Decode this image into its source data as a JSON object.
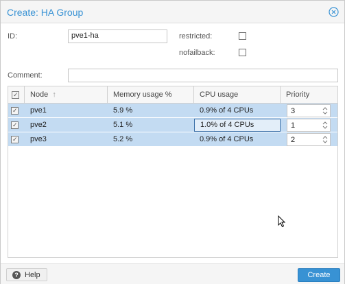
{
  "dialog": {
    "title": "Create: HA Group",
    "close_icon": "close-circle-icon",
    "accent": "#3892d4"
  },
  "form": {
    "id_label": "ID:",
    "id_value": "pve1-ha",
    "restricted_label": "restricted:",
    "restricted_checked": false,
    "nofailback_label": "nofailback:",
    "nofailback_checked": false,
    "comment_label": "Comment:",
    "comment_value": ""
  },
  "grid": {
    "columns": [
      "Node",
      "Memory usage %",
      "CPU usage",
      "Priority"
    ],
    "sort_icon": "sort-ascending-arrow-icon",
    "rows": [
      {
        "node": "pve1",
        "memory": "5.9 %",
        "cpu": "0.9% of 4 CPUs",
        "priority": "3",
        "checked": true
      },
      {
        "node": "pve2",
        "memory": "5.1 %",
        "cpu": "1.0% of 4 CPUs",
        "priority": "1",
        "checked": true
      },
      {
        "node": "pve3",
        "memory": "5.2 %",
        "cpu": "0.9% of 4 CPUs",
        "priority": "2",
        "checked": true
      }
    ],
    "selection_color": "#c3dbf2"
  },
  "footer": {
    "help_label": "Help",
    "help_icon": "question-circle-icon",
    "create_label": "Create"
  }
}
